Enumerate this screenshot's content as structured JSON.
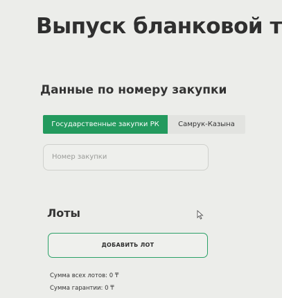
{
  "page": {
    "title": "Выпуск бланковой те"
  },
  "procurement": {
    "section_title": "Данные по номеру закупки",
    "tabs": [
      {
        "label": "Государственные закупки РК",
        "active": true
      },
      {
        "label": "Самрук-Казына",
        "active": false
      }
    ],
    "number_input": {
      "placeholder": "Номер закупки",
      "value": ""
    }
  },
  "lots": {
    "title": "Лоты",
    "add_button_label": "ДОБАВИТЬ ЛОТ",
    "total_lots_label": "Сумма всех лотов: 0 ₸",
    "guarantee_label": "Сумма гарантии: 0 ₸"
  },
  "colors": {
    "accent": "#239a5e",
    "background": "#ecedea"
  },
  "icons": {
    "cursor": "mouse-pointer-icon"
  }
}
